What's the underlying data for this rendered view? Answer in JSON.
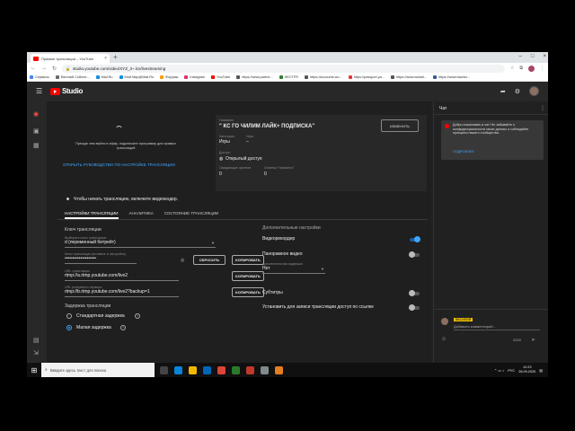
{
  "browser": {
    "tab_title": "Прямые трансляции – YouTube",
    "tab_close": "×",
    "new_tab": "+",
    "win_controls": [
      "–",
      "□",
      "×"
    ],
    "url": "studio.youtube.com/video/XYZ_3~.lcs/livestreaming",
    "bookmarks": [
      {
        "label": "Сервисы",
        "color": "#4285f4"
      },
      {
        "label": "Евгений Соболе...",
        "color": "#6a6a6a"
      },
      {
        "label": "Mail.Ru",
        "color": "#168de2"
      },
      {
        "label": "Мой Мир@Mail.Ru",
        "color": "#168de2"
      },
      {
        "label": "Форумы",
        "color": "#f59e0b"
      },
      {
        "label": "Instagram",
        "color": "#e1306c"
      },
      {
        "label": "YouTube",
        "color": "#ff0000"
      },
      {
        "label": "https://www.partne...",
        "color": "#555555"
      },
      {
        "label": "HECTFR",
        "color": "#2e7d32"
      },
      {
        "label": "https://accounts.wo...",
        "color": "#555555"
      },
      {
        "label": "https://passport.ya...",
        "color": "#e53935"
      },
      {
        "label": "https://www.wolsbl...",
        "color": "#555555"
      },
      {
        "label": "https://www.facebo...",
        "color": "#3b5998"
      }
    ]
  },
  "header": {
    "logo_text": "Studio"
  },
  "preview": {
    "hint": "Прежде чем выйти в эфир, подключите программу для прямых трансляций",
    "link": "ОТКРЫТЬ РУКОВОДСТВО ПО НАСТРОЙКЕ ТРАНСЛЯЦИИ"
  },
  "meta": {
    "title_label": "Название",
    "title_value": "\" КС ГО ЧИЛИМ ЛАЙК+ ПОДПИСКА\"",
    "edit_button": "ИЗМЕНИТЬ",
    "category_label": "Категория",
    "category_value": "Игры",
    "game_label": "Игра",
    "game_value": "–",
    "access_label": "Доступ",
    "access_value": "Открытый доступ",
    "waiting_label": "Ожидающие зрители",
    "waiting_value": "0",
    "likes_label": "Отметки \"Нравится\"",
    "likes_value": "0"
  },
  "encoder_hint": "Чтобы начать трансляцию, включите видеокодер.",
  "tabs": [
    "НАСТРОЙКИ ТРАНСЛЯЦИИ",
    "АНАЛИТИКА",
    "СОСТОЯНИЕ ТРАНСЛЯЦИИ"
  ],
  "settings": {
    "key_heading": "Ключ трансляции",
    "key_select_label": "Выберите ключ трансляции",
    "key_select_value": "d (переменный битрейт)",
    "key_field_label": "Ключ трансляции (вставьте в настройки)",
    "key_field_value": "••••••••••••••••••••",
    "reset_button": "СБРОСИТЬ",
    "copy_button": "КОПИРОВАТЬ",
    "url_label": "URL трансляции",
    "url_value": "rtmp://a.rtmp.youtube.com/live2",
    "backup_label": "URL резервного сервера",
    "backup_value": "rtmp://b.rtmp.youtube.com/live2?backup=1",
    "latency_heading": "Задержка трансляции",
    "latency_standard": "Стандартная задержка",
    "latency_low": "Малая задержка",
    "latency_selected": "low",
    "help_glyph": "?"
  },
  "extra": {
    "heading": "Дополнительные настройки",
    "dvr": "Видеорекордер",
    "dvr_on": true,
    "panoramic": "Панорамное видео",
    "panoramic_on": false,
    "extra_select_label": "Дополнительная задержка",
    "extra_select_value": "Нет",
    "subtitles": "Субтитры",
    "subtitles_on": false,
    "age_restriction": "Установить для записи трансляции доступ по ссылке",
    "age_on": false
  },
  "chat": {
    "title": "Чат",
    "welcome": "Добро пожаловать в чат! Не забывайте о конфиденциальности своих данных и соблюдайте принципы нашего сообщества.",
    "welcome_link": "ПОДРОБНЕЕ",
    "username": "ВАСИЛИЙ",
    "input_placeholder": "Добавить комментарий...",
    "counter": "0/200"
  },
  "taskbar": {
    "search_placeholder": "Введите здесь текст для поиска",
    "lang": "РУС",
    "time": "12:23",
    "date": "26.09.2020"
  },
  "colors": {
    "accent": "#3ea6ff",
    "brand": "#ff0000",
    "bg": "#1f1f1f"
  }
}
